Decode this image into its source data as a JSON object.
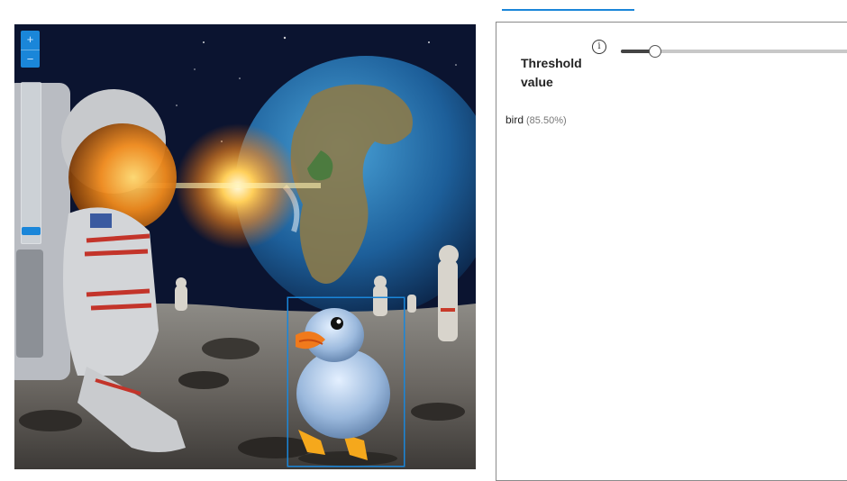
{
  "viewer": {
    "zoom_in_label": "+",
    "zoom_out_label": "−",
    "zoom_level": 0.03
  },
  "panel": {
    "threshold_label": "Threshold value",
    "info_icon_glyph": "i",
    "threshold_value": 0.15
  },
  "detections": [
    {
      "label": "bird",
      "confidence": "(85.50%)"
    }
  ],
  "colors": {
    "accent": "#1a86d9",
    "slider_fill": "#444444",
    "slider_rail": "#c8c8c8"
  }
}
